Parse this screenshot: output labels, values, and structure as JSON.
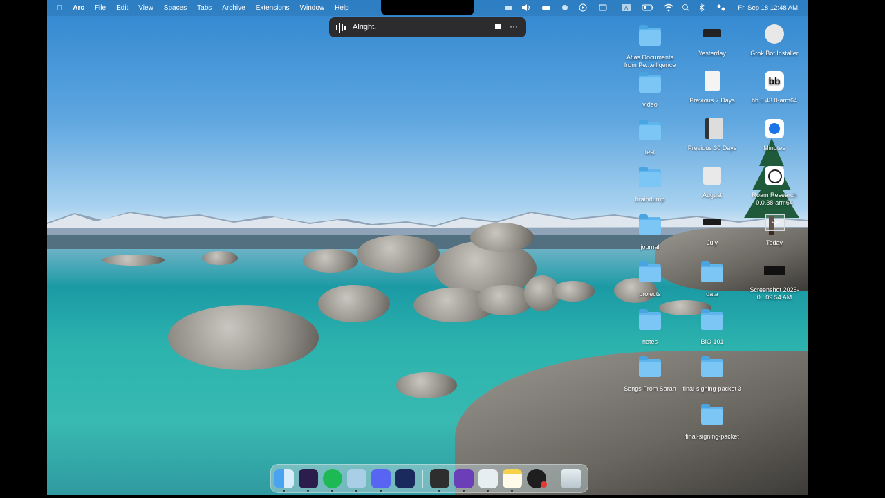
{
  "menubar": {
    "apple": "",
    "app": "Arc",
    "items": [
      "File",
      "Edit",
      "View",
      "Spaces",
      "Tabs",
      "Archive",
      "Extensions",
      "Window",
      "Help"
    ],
    "clock": "Fri Sep 18  12:48 AM"
  },
  "dictation": {
    "text": "Alright.",
    "more": "···"
  },
  "desktop": {
    "col1": [
      {
        "label": "Atlas Documents from Pe...elligence"
      },
      {
        "label": "video"
      },
      {
        "label": "test"
      },
      {
        "label": "braindump"
      },
      {
        "label": "journal"
      },
      {
        "label": "projects"
      },
      {
        "label": "notes"
      },
      {
        "label": "Songs From Sarah"
      }
    ],
    "col2": [
      {
        "label": "Yesterday"
      },
      {
        "label": "Previous 7 Days"
      },
      {
        "label": "Previous 30 Days"
      },
      {
        "label": "August"
      },
      {
        "label": "July"
      },
      {
        "label": "data"
      },
      {
        "label": "BIO 101"
      },
      {
        "label": "final-signing-packet 3"
      },
      {
        "label": "final-signing-packet"
      }
    ],
    "col3": [
      {
        "label": "Grok Bot Installer"
      },
      {
        "label": "bb 0.43.0-arm64"
      },
      {
        "label": "Minutes"
      },
      {
        "label": "Roam Research 0.0.38-arm64"
      },
      {
        "label": "Today"
      },
      {
        "label": "Screenshot 2026-0...09.54 AM"
      }
    ]
  },
  "dock": {
    "apps": [
      "finder-icon",
      "affinity-icon",
      "spotify-icon",
      "tableplus-icon",
      "discord-icon",
      "app-icon",
      "box-icon",
      "arc-icon",
      "figure-icon",
      "notes-icon",
      "activity-icon",
      "trash-icon"
    ]
  }
}
